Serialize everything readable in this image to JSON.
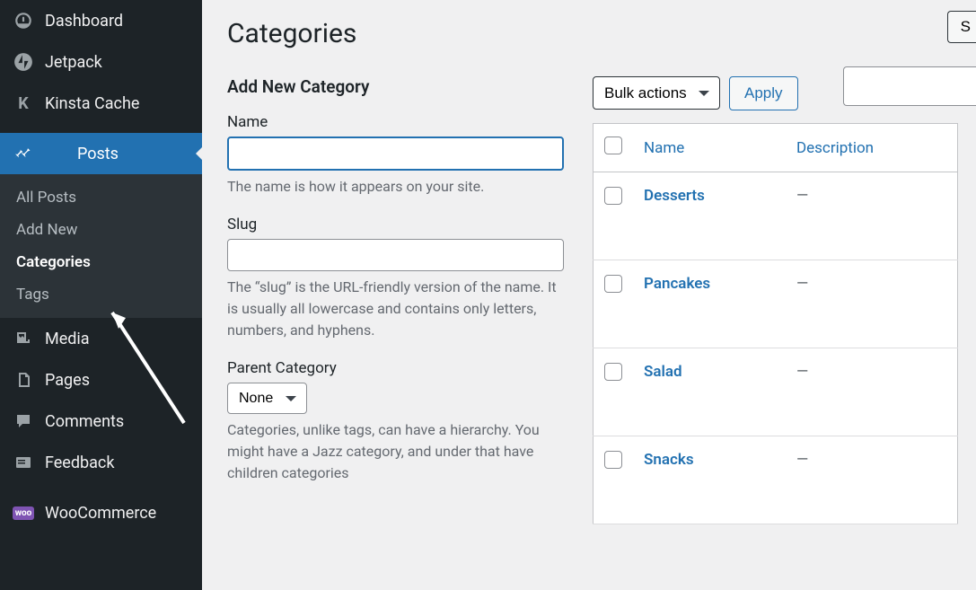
{
  "sidebar": {
    "items": [
      {
        "label": "Dashboard",
        "icon": "dashboard"
      },
      {
        "label": "Jetpack",
        "icon": "jetpack"
      },
      {
        "label": "Kinsta Cache",
        "icon": "kinsta"
      },
      {
        "label": "Posts",
        "icon": "pin",
        "active": true
      },
      {
        "label": "Media",
        "icon": "media"
      },
      {
        "label": "Pages",
        "icon": "pages"
      },
      {
        "label": "Comments",
        "icon": "comments"
      },
      {
        "label": "Feedback",
        "icon": "feedback"
      },
      {
        "label": "WooCommerce",
        "icon": "woo"
      }
    ],
    "submenu": [
      {
        "label": "All Posts"
      },
      {
        "label": "Add New"
      },
      {
        "label": "Categories",
        "current": true
      },
      {
        "label": "Tags"
      }
    ]
  },
  "page": {
    "title": "Categories",
    "top_button_partial": "S",
    "search_value": ""
  },
  "form": {
    "heading": "Add New Category",
    "name": {
      "label": "Name",
      "value": "",
      "help": "The name is how it appears on your site."
    },
    "slug": {
      "label": "Slug",
      "value": "",
      "help": "The “slug” is the URL-friendly version of the name. It is usually all lowercase and contains only letters, numbers, and hyphens."
    },
    "parent": {
      "label": "Parent Category",
      "selected": "None",
      "help": "Categories, unlike tags, can have a hierarchy. You might have a Jazz category, and under that have children categories"
    }
  },
  "tablenav": {
    "bulk_label": "Bulk actions",
    "apply_label": "Apply"
  },
  "table": {
    "headers": {
      "name": "Name",
      "description": "Description"
    },
    "rows": [
      {
        "name": "Desserts",
        "description": "—"
      },
      {
        "name": "Pancakes",
        "description": "—"
      },
      {
        "name": "Salad",
        "description": "—"
      },
      {
        "name": "Snacks",
        "description": "—"
      }
    ]
  }
}
